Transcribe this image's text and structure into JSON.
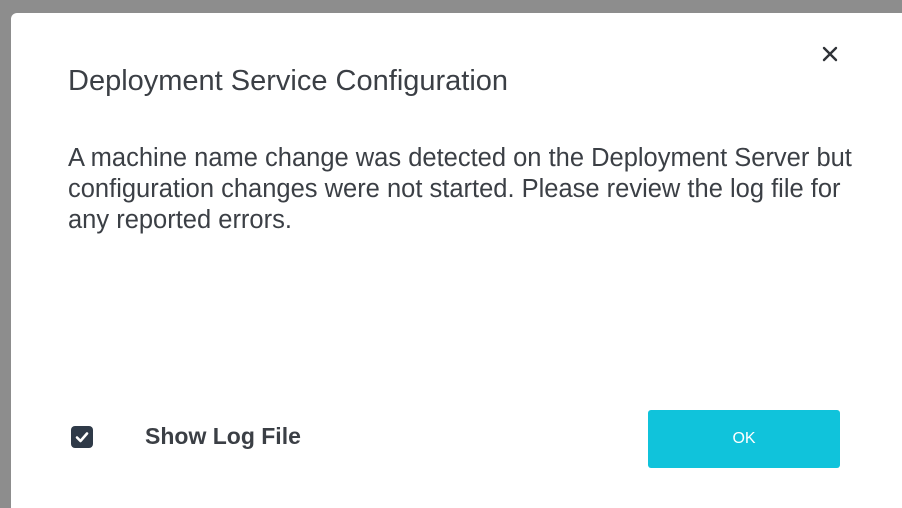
{
  "dialog": {
    "title": "Deployment Service Configuration",
    "message": "A machine name change was detected on the Deployment Server but configuration changes were not started. Please review the log file for any reported errors.",
    "close_icon": "close-icon",
    "show_log_checkbox": {
      "label": "Show Log File",
      "checked": true
    },
    "ok_button": {
      "label": "OK"
    }
  },
  "colors": {
    "backdrop": "#8d8d8d",
    "dialog_bg": "#ffffff",
    "text": "#3b3f45",
    "checkbox": "#2f3a48",
    "primary_button": "#10c3db"
  }
}
